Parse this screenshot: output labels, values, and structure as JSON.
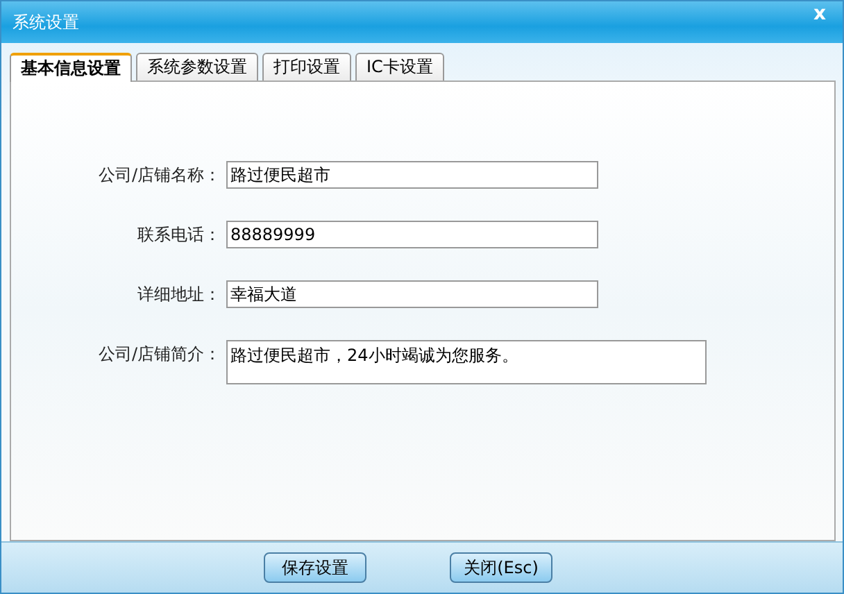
{
  "window": {
    "title": "系统设置",
    "close": "x"
  },
  "tabs": [
    {
      "label": "基本信息设置",
      "selected": true
    },
    {
      "label": "系统参数设置",
      "selected": false
    },
    {
      "label": "打印设置",
      "selected": false
    },
    {
      "label": "IC卡设置",
      "selected": false
    }
  ],
  "fields": [
    {
      "label": "公司/店铺名称：",
      "value": "路过便民超市",
      "kind": "line"
    },
    {
      "label": "联系电话：",
      "value": "88889999",
      "kind": "line"
    },
    {
      "label": "详细地址：",
      "value": "幸福大道",
      "kind": "line"
    },
    {
      "label": "公司/店铺简介：",
      "value": "路过便民超市，24小时竭诚为您服务。",
      "kind": "multiline"
    }
  ],
  "buttons": [
    "保存设置",
    "关闭(Esc)"
  ]
}
